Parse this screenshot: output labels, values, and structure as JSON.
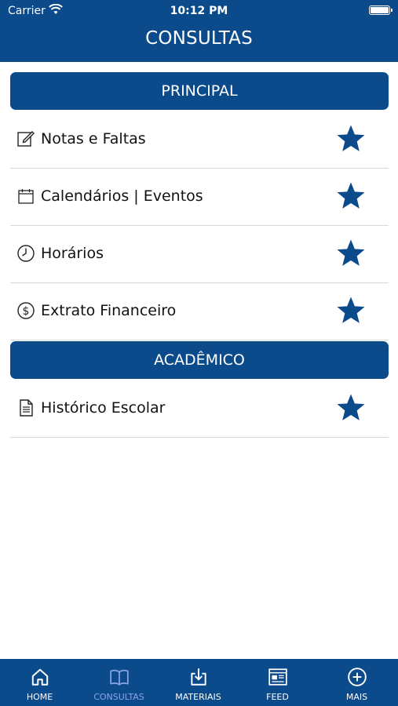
{
  "status": {
    "carrier": "Carrier",
    "time": "10:12 PM"
  },
  "header": {
    "title": "CONSULTAS"
  },
  "sections": [
    {
      "title": "PRINCIPAL",
      "items": [
        {
          "label": "Notas e Faltas",
          "icon": "edit-icon"
        },
        {
          "label": "Calendários | Eventos",
          "icon": "calendar-icon"
        },
        {
          "label": "Horários",
          "icon": "clock-icon"
        },
        {
          "label": "Extrato Financeiro",
          "icon": "dollar-icon"
        }
      ]
    },
    {
      "title": "ACADÊMICO",
      "items": [
        {
          "label": "Histórico Escolar",
          "icon": "document-icon"
        }
      ]
    }
  ],
  "tabs": [
    {
      "label": "HOME",
      "icon": "home-icon"
    },
    {
      "label": "CONSULTAS",
      "icon": "book-icon",
      "active": true
    },
    {
      "label": "MATERIAIS",
      "icon": "download-icon"
    },
    {
      "label": "FEED",
      "icon": "newspaper-icon"
    },
    {
      "label": "MAIS",
      "icon": "plus-circle-icon"
    }
  ],
  "colors": {
    "brand": "#0b4a8b",
    "active_tab": "#8aa4e6",
    "star": "#0b4a8b",
    "divider": "#d8d8d8"
  }
}
